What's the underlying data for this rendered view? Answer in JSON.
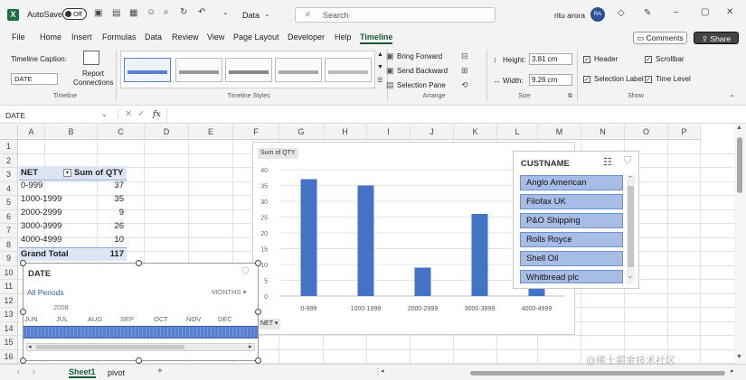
{
  "titlebar": {
    "autosave": "AutoSave",
    "toggle": "Off",
    "workbook": "Data",
    "search_placeholder": "Search",
    "user": "ritu arora",
    "avatar": "RA"
  },
  "ribbon_tabs": [
    "File",
    "Home",
    "Insert",
    "Formulas",
    "Data",
    "Review",
    "View",
    "Page Layout",
    "Developer",
    "Help",
    "Timeline"
  ],
  "active_tab": "Timeline",
  "comments_label": "Comments",
  "share_label": "Share",
  "ribbon": {
    "caption_label": "Timeline Caption:",
    "caption_value": "DATE",
    "report_connections": [
      "Report",
      "Connections"
    ],
    "group_timeline": "Timeline",
    "group_styles": "Timeline Styles",
    "group_arrange": "Arrange",
    "group_size": "Size",
    "group_show": "Show",
    "bring_forward": "Bring Forward",
    "send_backward": "Send Backward",
    "selection_pane": "Selection Pane",
    "height_label": "Height:",
    "height_value": "3.81 cm",
    "width_label": "Width:",
    "width_value": "9.26 cm",
    "show_header": "Header",
    "show_scrollbar": "Scrollbar",
    "show_selection_label": "Selection Label",
    "show_time_level": "Time Level"
  },
  "formula_bar": {
    "name_box": "DATE",
    "fx": "fx",
    "value": ""
  },
  "columns": [
    "A",
    "B",
    "C",
    "D",
    "E",
    "F",
    "G",
    "H",
    "I",
    "J",
    "K",
    "L",
    "M",
    "N",
    "O",
    "P"
  ],
  "rows": [
    "1",
    "2",
    "3",
    "4",
    "5",
    "6",
    "7",
    "8",
    "9",
    "10",
    "11",
    "12",
    "13",
    "14",
    "15",
    "16",
    "17"
  ],
  "pivot": {
    "header": [
      "NET",
      "Sum of QTY"
    ],
    "rows": [
      [
        "0-999",
        "37"
      ],
      [
        "1000-1999",
        "35"
      ],
      [
        "2000-2999",
        "9"
      ],
      [
        "3000-3999",
        "26"
      ],
      [
        "4000-4999",
        "10"
      ]
    ],
    "total": [
      "Grand Total",
      "117"
    ]
  },
  "chart_data": {
    "type": "bar",
    "title": "",
    "field_button": "Sum of QTY",
    "axis_field_button": "NET",
    "categories": [
      "0-999",
      "1000-1999",
      "2000-2999",
      "3000-3999",
      "4000-4999"
    ],
    "values": [
      37,
      35,
      9,
      26,
      10
    ],
    "ylim": [
      0,
      40
    ],
    "yticks": [
      0,
      5,
      10,
      15,
      20,
      25,
      30,
      35,
      40
    ],
    "grid": true,
    "bar_color": "#4472c4"
  },
  "slicer": {
    "title": "CUSTNAME",
    "items": [
      "Anglo American",
      "Filofax UK",
      "P&O Shipping",
      "Rolls Royce",
      "Shell Oil",
      "Whitbread plc"
    ]
  },
  "timeline": {
    "title": "DATE",
    "periods": "All Periods",
    "level": "MONTHS",
    "year": "2008",
    "months": [
      "JUN",
      "JUL",
      "AUG",
      "SEP",
      "OCT",
      "NOV",
      "DEC"
    ]
  },
  "sheets": [
    "Sheet1",
    "pivot"
  ],
  "active_sheet": "Sheet1",
  "watermark": "@稀土掘金技术社区",
  "colors": {
    "excel_green": "#185c37",
    "bar": "#4472c4",
    "slicer_item": "#a8bde6",
    "timeline_bar": "#5b7fd0"
  }
}
